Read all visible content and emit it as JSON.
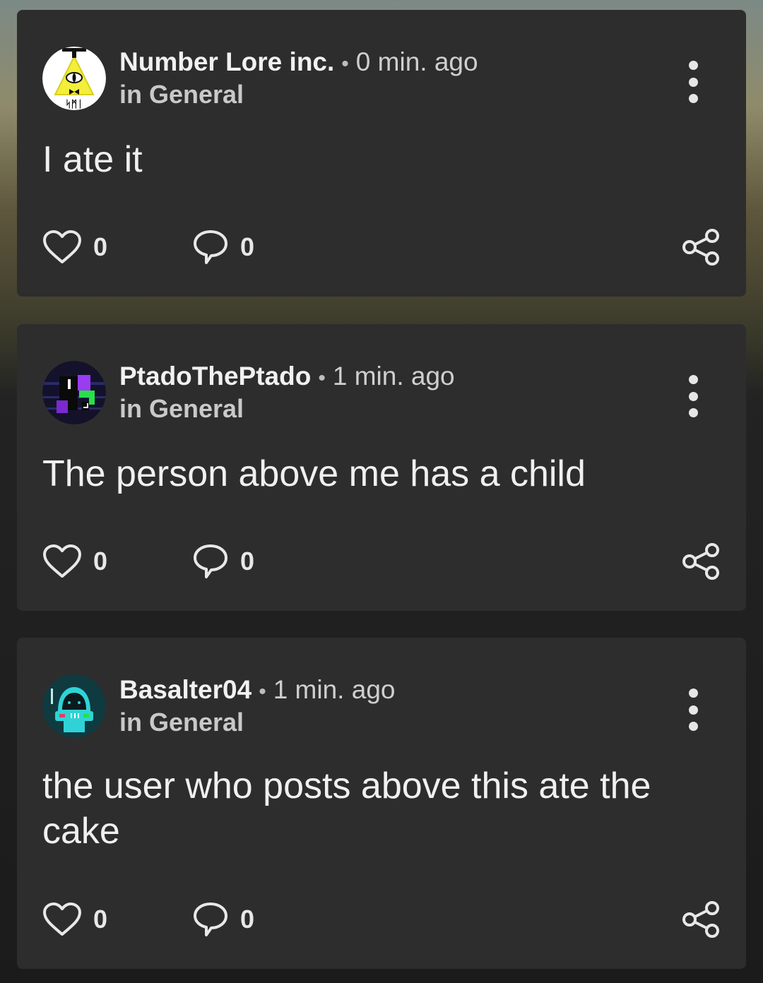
{
  "posts": [
    {
      "author": "Number Lore inc.",
      "separator": "•",
      "time": "0 min. ago",
      "community": "in General",
      "body": "I ate it",
      "likes": "0",
      "comments": "0",
      "avatar_icon": "triangle-eye-avatar-icon"
    },
    {
      "author": "PtadoThePtado",
      "separator": "•",
      "time": "1 min. ago",
      "community": "in General",
      "body": "The person above me has a child",
      "likes": "0",
      "comments": "0",
      "avatar_icon": "pixel-face-avatar-icon"
    },
    {
      "author": "Basalter04",
      "separator": "•",
      "time": "1 min. ago",
      "community": "in General",
      "body": "the user who posts above this ate the cake",
      "likes": "0",
      "comments": "0",
      "avatar_icon": "robot-helmet-avatar-icon"
    }
  ],
  "colors": {
    "card": "#2d2d2d",
    "text": "#f0f0f0",
    "accent_yellow": "#f3ee3a",
    "accent_cyan": "#2fd3d6"
  }
}
